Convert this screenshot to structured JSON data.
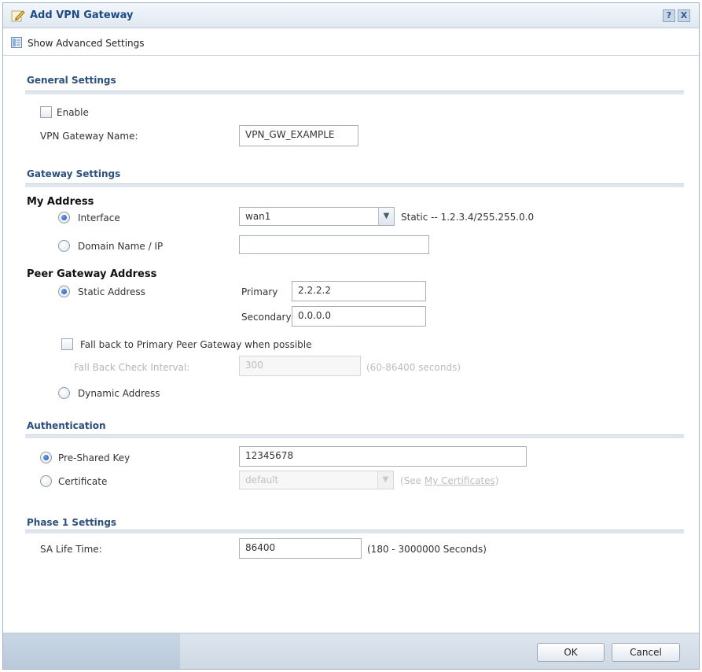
{
  "window": {
    "title": "Add VPN Gateway",
    "help_label": "?",
    "close_label": "X"
  },
  "toolbar": {
    "advanced_label": "Show Advanced Settings"
  },
  "general": {
    "title": "General Settings",
    "enable_label": "Enable",
    "enable_checked": false,
    "name_label": "VPN Gateway Name:",
    "name_value": "VPN_GW_EXAMPLE"
  },
  "gateway": {
    "title": "Gateway Settings",
    "my_address": {
      "title": "My Address",
      "interface_label": "Interface",
      "interface_value": "wan1",
      "interface_info": "Static -- 1.2.3.4/255.255.0.0",
      "domain_label": "Domain Name / IP",
      "domain_value": ""
    },
    "peer": {
      "title": "Peer Gateway Address",
      "static_label": "Static Address",
      "primary_label": "Primary",
      "primary_value": "2.2.2.2",
      "secondary_label": "Secondary",
      "secondary_value": "0.0.0.0",
      "fallback_label": "Fall back to Primary Peer Gateway when possible",
      "fallback_checked": false,
      "interval_label": "Fall Back Check Interval:",
      "interval_value": "300",
      "interval_range": "(60-86400 seconds)",
      "dynamic_label": "Dynamic Address"
    }
  },
  "auth": {
    "title": "Authentication",
    "psk_label": "Pre-Shared Key",
    "psk_value": "12345678",
    "cert_label": "Certificate",
    "cert_value": "default",
    "cert_hint_prefix": "(See ",
    "cert_hint_link": "My Certificates",
    "cert_hint_suffix": ")"
  },
  "phase1": {
    "title": "Phase 1 Settings",
    "sa_label": "SA Life Time:",
    "sa_value": "86400",
    "sa_range": "(180 - 3000000 Seconds)"
  },
  "footer": {
    "ok_label": "OK",
    "cancel_label": "Cancel"
  },
  "colors": {
    "title_text": "#1f4a86",
    "section_title": "#2b4f7e",
    "radio_dot": "#1d55b0"
  }
}
